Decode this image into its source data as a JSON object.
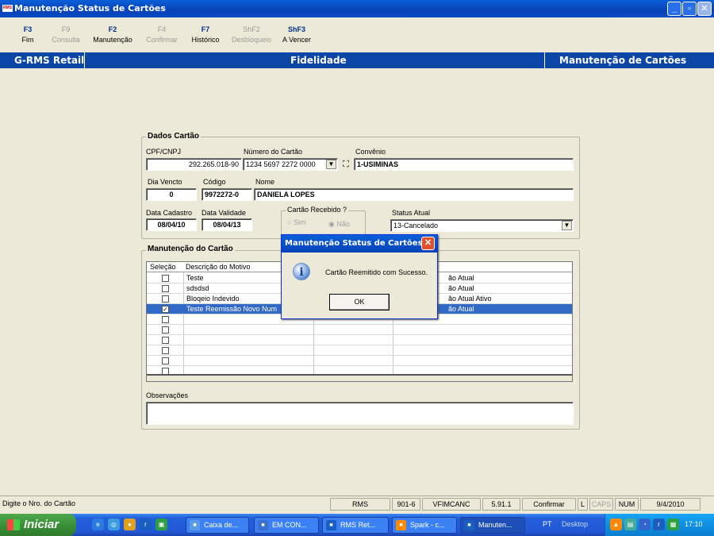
{
  "window": {
    "title": "Manutenção Status de Cartões",
    "icon": "RMS"
  },
  "fkeys": [
    {
      "key": "F3",
      "label": "Fim",
      "enabled": true
    },
    {
      "key": "F9",
      "label": "Consulta",
      "enabled": false
    },
    {
      "key": "F2",
      "label": "Manutenção",
      "enabled": true
    },
    {
      "key": "F4",
      "label": "Confirmar",
      "enabled": false
    },
    {
      "key": "F7",
      "label": "Histórico",
      "enabled": true
    },
    {
      "key": "ShF2",
      "label": "Desbloqueio",
      "enabled": false
    },
    {
      "key": "ShF3",
      "label": "A Vencer",
      "enabled": true
    }
  ],
  "band": {
    "left": "G-RMS Retail",
    "center": "Fidelidade",
    "right": "Manutenção de Cartões"
  },
  "dados": {
    "title": "Dados Cartão",
    "cpf_label": "CPF/CNPJ",
    "cpf": "292.265.018-90",
    "numero_label": "Número do Cartão",
    "numero": "1234 5697 2272 0000",
    "convenio_label": "Convênio",
    "convenio": "1-USIMINAS",
    "vencto_label": "Dia Vencto",
    "vencto": "0",
    "codigo_label": "Código",
    "codigo": "9972272-0",
    "nome_label": "Nome",
    "nome": "DANIELA LOPES",
    "cadastro_label": "Data Cadastro",
    "cadastro": "08/04/10",
    "validade_label": "Data Validade",
    "validade": "08/04/13",
    "recebido_label": "Cartão Recebido ?",
    "sim": "Sim",
    "nao": "Não",
    "status_label": "Status Atual",
    "status": "13-Cancelado"
  },
  "manut": {
    "title": "Manutenção do Cartão",
    "col_sel": "Seleção",
    "col_desc": "Descrição do Motivo",
    "rows": [
      {
        "checked": false,
        "desc": "Teste",
        "status": "ão Atual",
        "selected": false
      },
      {
        "checked": false,
        "desc": "sdsdsd",
        "status": "ão Atual",
        "selected": false
      },
      {
        "checked": false,
        "desc": "Bloqeio Indevido",
        "status": "ão Atual Ativo",
        "selected": false
      },
      {
        "checked": true,
        "desc": "Teste Reemissão Novo Num",
        "status": "ão Atual",
        "selected": true
      },
      {
        "checked": false,
        "desc": "",
        "status": "",
        "selected": false
      },
      {
        "checked": false,
        "desc": "",
        "status": "",
        "selected": false
      },
      {
        "checked": false,
        "desc": "",
        "status": "",
        "selected": false
      },
      {
        "checked": false,
        "desc": "",
        "status": "",
        "selected": false
      },
      {
        "checked": false,
        "desc": "",
        "status": "",
        "selected": false
      },
      {
        "checked": false,
        "desc": "",
        "status": "",
        "selected": false
      }
    ],
    "obs_label": "Observações"
  },
  "dialog": {
    "title": "Manutenção Status de Cartões",
    "message": "Cartão Reemitido com Sucesso.",
    "ok": "OK"
  },
  "status": {
    "hint": "Digite o Nro. do Cartão",
    "sys": "RMS",
    "code": "901-6",
    "prog": "VFIMCANC",
    "version": "5.91.1",
    "mode": "Confirmar",
    "l": "L",
    "caps": "CAPS",
    "num": "NUM",
    "date": "9/4/2010"
  },
  "taskbar": {
    "start": "Iniciar",
    "items": [
      "Caixa de...",
      "EM CON...",
      "RMS Ret...",
      "Spark - c...",
      "Manuten..."
    ],
    "lang": "PT",
    "desktop": "Desktop",
    "clock": "17:10"
  }
}
